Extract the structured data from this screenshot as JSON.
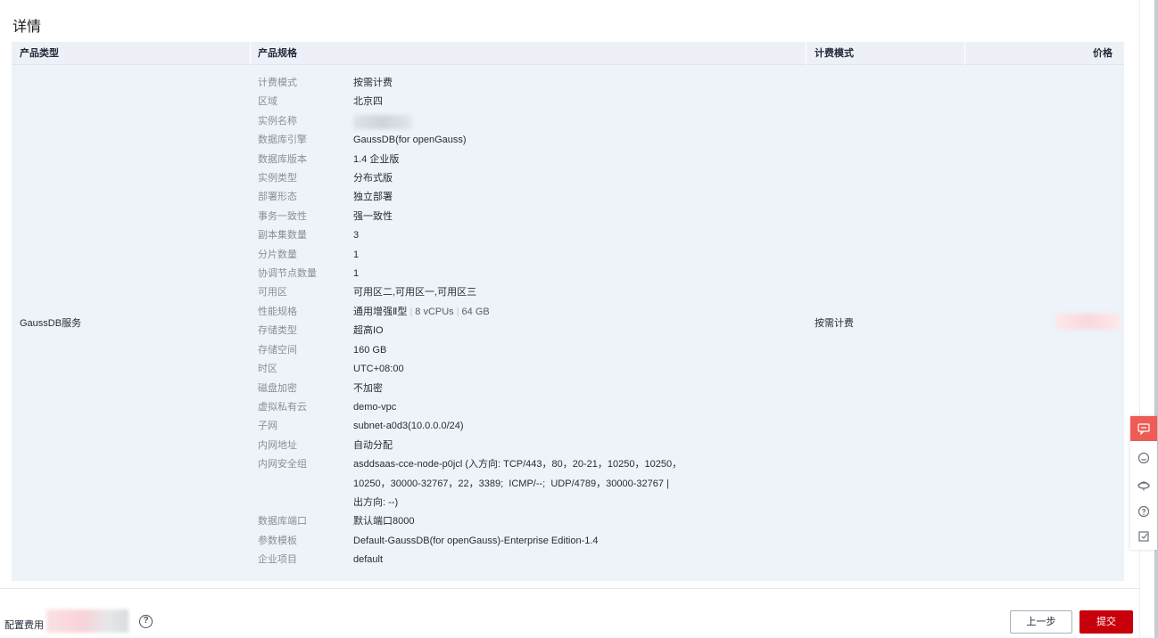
{
  "page": {
    "title": "详情"
  },
  "table": {
    "headers": [
      "产品类型",
      "产品规格",
      "计费模式",
      "价格"
    ],
    "row": {
      "product_type": "GaussDB服务",
      "billing_mode": "按需计费",
      "price": ""
    },
    "specs": [
      {
        "key": "计费模式",
        "value": "按需计费"
      },
      {
        "key": "区域",
        "value": "北京四"
      },
      {
        "key": "实例名称",
        "value": ""
      },
      {
        "key": "数据库引擎",
        "value": "GaussDB(for openGauss)"
      },
      {
        "key": "数据库版本",
        "value": "1.4 企业版"
      },
      {
        "key": "实例类型",
        "value": "分布式版"
      },
      {
        "key": "部署形态",
        "value": "独立部署"
      },
      {
        "key": "事务一致性",
        "value": "强一致性"
      },
      {
        "key": "副本集数量",
        "value": "3"
      },
      {
        "key": "分片数量",
        "value": "1"
      },
      {
        "key": "协调节点数量",
        "value": "1"
      },
      {
        "key": "可用区",
        "value": "可用区二,可用区一,可用区三"
      },
      {
        "key": "性能规格",
        "value": "通用增强Ⅱ型",
        "cpu": "8 vCPUs",
        "mem": "64 GB"
      },
      {
        "key": "存储类型",
        "value": "超高IO"
      },
      {
        "key": "存储空间",
        "value": "160 GB"
      },
      {
        "key": "时区",
        "value": "UTC+08:00"
      },
      {
        "key": "磁盘加密",
        "value": "不加密"
      },
      {
        "key": "虚拟私有云",
        "value": "demo-vpc"
      },
      {
        "key": "子网",
        "value": "subnet-a0d3(10.0.0.0/24)"
      },
      {
        "key": "内网地址",
        "value": "自动分配"
      },
      {
        "key": "内网安全组",
        "value": "asddsaas-cce-node-p0jcl (入方向: TCP/443，80，20-21，10250，10250，\n10250，30000-32767，22，3389;  ICMP/--;  UDP/4789，30000-32767 |\n出方向: --)"
      },
      {
        "key": "数据库端口",
        "value": "默认端口8000"
      },
      {
        "key": "参数模板",
        "value": "Default-GaussDB(for openGauss)-Enterprise Edition-1.4"
      },
      {
        "key": "企业项目",
        "value": "default"
      }
    ]
  },
  "footer": {
    "fee_label": "配置费用",
    "help_symbol": "?",
    "prev_button": "上一步",
    "submit_button": "提交"
  },
  "float_toolbar": {
    "items": [
      "chat-icon",
      "smile-icon",
      "headset-icon",
      "question-icon",
      "edit-icon"
    ],
    "active_color": "#ee5c55"
  },
  "colors": {
    "primary": "#c7000b",
    "table_bg": "#eef3f9"
  }
}
